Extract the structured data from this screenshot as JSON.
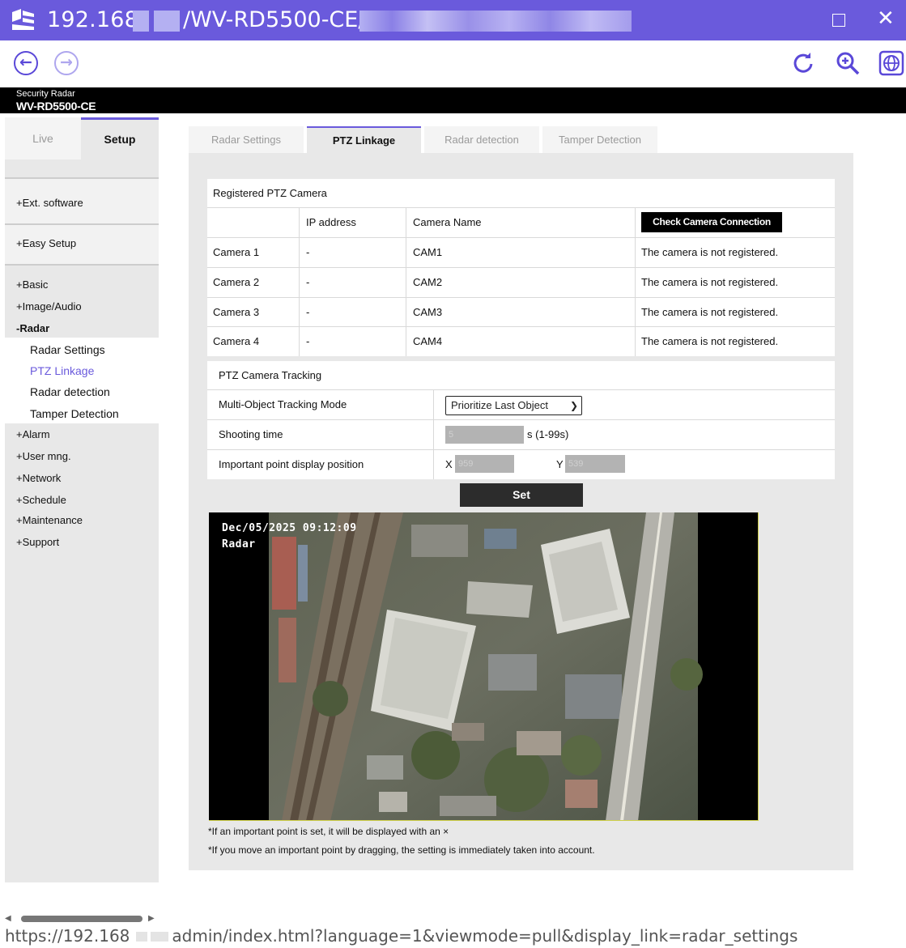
{
  "window": {
    "title_part1": "192.168",
    "title_part2": "/WV-RD5500-CE/",
    "maximize_icon": "maximize-icon",
    "close_icon": "close-icon",
    "close_glyph": "✕",
    "colors": {
      "titlebar": "#6a5adc",
      "accent": "#6a5adc",
      "redaction": "#b4b0f2"
    }
  },
  "toolbar": {
    "back_glyph": "←",
    "forward_glyph": "→",
    "icons": [
      "back-icon",
      "forward-icon",
      "refresh-icon",
      "zoom-in-icon",
      "globe-icon"
    ]
  },
  "product": {
    "subtitle": "Security Radar",
    "model": "WV-RD5500-CE"
  },
  "mode_tabs": {
    "live": "Live",
    "setup": "Setup"
  },
  "sidebar": {
    "ext_software": "+Ext. software",
    "easy_setup": "+Easy Setup",
    "basic": "+Basic",
    "image_audio": "+Image/Audio",
    "radar": "-Radar",
    "radar_sub": [
      "Radar Settings",
      "PTZ Linkage",
      "Radar detection",
      "Tamper Detection"
    ],
    "alarm": "+Alarm",
    "user_mng": "+User mng.",
    "network": "+Network",
    "schedule": "+Schedule",
    "maintenance": "+Maintenance",
    "support": "+Support"
  },
  "tabs": [
    "Radar Settings",
    "PTZ Linkage",
    "Radar detection",
    "Tamper Detection"
  ],
  "registered": {
    "title": "Registered PTZ Camera",
    "col_ip": "IP address",
    "col_name": "Camera Name",
    "check_button": "Check Camera Connection",
    "rows": [
      {
        "label": "Camera 1",
        "ip": "-",
        "name": "CAM1",
        "status": "The camera is not registered."
      },
      {
        "label": "Camera 2",
        "ip": "-",
        "name": "CAM2",
        "status": "The camera is not registered."
      },
      {
        "label": "Camera 3",
        "ip": "-",
        "name": "CAM3",
        "status": "The camera is not registered."
      },
      {
        "label": "Camera 4",
        "ip": "-",
        "name": "CAM4",
        "status": "The camera is not registered."
      }
    ]
  },
  "tracking": {
    "title": "PTZ Camera Tracking",
    "mode_label": "Multi-Object Tracking Mode",
    "mode_value": "Prioritize Last Object",
    "shooting_label": "Shooting time",
    "shooting_value": "5",
    "shooting_unit": "s (1-99s)",
    "point_label": "Important point display position",
    "x_label": "X",
    "x_value": "959",
    "y_label": "Y",
    "y_value": "539"
  },
  "set_button": "Set",
  "video": {
    "timestamp": "Dec/05/2025 09:12:09",
    "label": "Radar"
  },
  "notes": [
    "*If an important point is set, it will be displayed with an ×",
    "*If you move an important point by dragging, the setting is immediately taken into account."
  ],
  "status_url": {
    "prefix": "https://192.168",
    "suffix": "admin/index.html?language=1&viewmode=pull&display_link=radar_settings"
  }
}
